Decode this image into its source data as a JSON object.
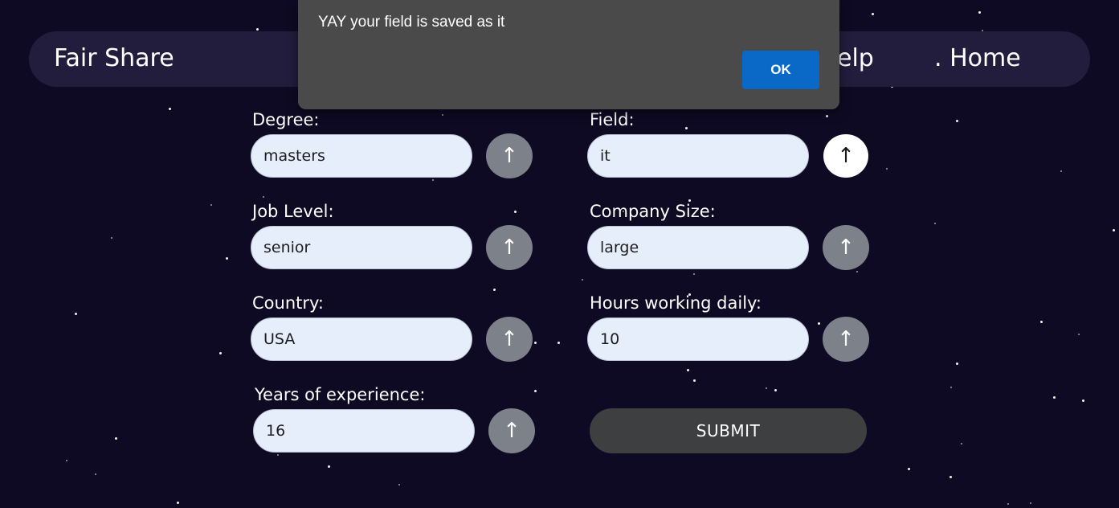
{
  "nav": {
    "brand": "Fair Share",
    "help_label": "elp",
    "home_label": ". Home"
  },
  "form": {
    "degree": {
      "label": "Degree:",
      "value": "masters"
    },
    "field": {
      "label": "Field:",
      "value": "it"
    },
    "job_level": {
      "label": "Job Level:",
      "value": "senior"
    },
    "company_size": {
      "label": "Company Size:",
      "value": "large"
    },
    "country": {
      "label": "Country:",
      "value": "USA"
    },
    "hours": {
      "label": "Hours working daily:",
      "value": "10"
    },
    "experience": {
      "label": "Years of experience:",
      "value": "16"
    },
    "arrow_glyph": "↑",
    "submit_label": "SUBMIT"
  },
  "dialog": {
    "message": "YAY your field is saved as it",
    "ok_label": "OK"
  },
  "colors": {
    "background": "#0f0a24",
    "navbar": "#221d3d",
    "input": "#e6eefb",
    "arrow_button": "#7d8189",
    "submit_button": "#3e3f40",
    "dialog": "#4a4a4a",
    "ok_button": "#0a69c6"
  }
}
